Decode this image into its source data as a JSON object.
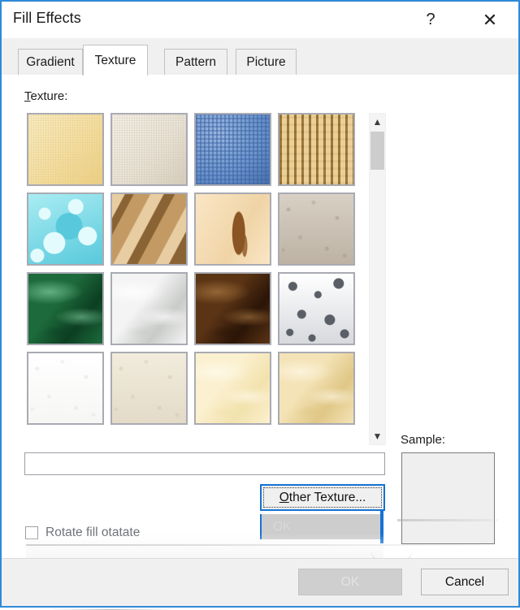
{
  "window": {
    "title": "Fill Effects",
    "help_icon": "question-mark-icon",
    "close_icon": "close-icon",
    "border_color": "#2f8ad9"
  },
  "tabs": [
    {
      "label": "Gradient",
      "active": false
    },
    {
      "label": "Texture",
      "active": true
    },
    {
      "label": "Pattern",
      "active": false
    },
    {
      "label": "Picture",
      "active": false
    }
  ],
  "texture_section": {
    "label": "Texture:",
    "accelerator": "T",
    "selected_name": "",
    "name_placeholder": "",
    "swatches": [
      {
        "name": "Papyrus",
        "c1": "#f2dda2",
        "c2": "#e8c878",
        "c3": "#f7ecc8",
        "kind": "weave-fine"
      },
      {
        "name": "Canvas",
        "c1": "#e9e2d5",
        "c2": "#cdc4b2",
        "c3": "#f4efe6",
        "kind": "weave-fine"
      },
      {
        "name": "Denim",
        "c1": "#6a93cc",
        "c2": "#3e65a3",
        "c3": "#9ab6e0",
        "kind": "weave-coarse"
      },
      {
        "name": "Woven mat",
        "c1": "#d8b169",
        "c2": "#8f6a2c",
        "c3": "#f0d7a4",
        "kind": "woven"
      },
      {
        "name": "Water droplets",
        "c1": "#a9ecf2",
        "c2": "#58c9dc",
        "c3": "#e4fbfd",
        "kind": "droplets"
      },
      {
        "name": "Paper bag",
        "c1": "#c49a64",
        "c2": "#8a6334",
        "c3": "#e8cda2",
        "kind": "crumple"
      },
      {
        "name": "Fish fossil",
        "c1": "#f0d4a6",
        "c2": "#8a5522",
        "c3": "#fae6c6",
        "kind": "fossil"
      },
      {
        "name": "Sand",
        "c1": "#bdb2a4",
        "c2": "#8e8173",
        "c3": "#d8d0c4",
        "kind": "grain"
      },
      {
        "name": "Green marble",
        "c1": "#1d6b3c",
        "c2": "#0c3f22",
        "c3": "#74c093",
        "kind": "marble"
      },
      {
        "name": "White marble",
        "c1": "#f3f4f3",
        "c2": "#c9cbc9",
        "c3": "#ffffff",
        "kind": "marble"
      },
      {
        "name": "Brown marble",
        "c1": "#5b3415",
        "c2": "#2a1507",
        "c3": "#a2713c",
        "kind": "marble"
      },
      {
        "name": "Granite",
        "c1": "#d7d9dd",
        "c2": "#5a5e66",
        "c3": "#ffffff",
        "kind": "speckle"
      },
      {
        "name": "Newsprint",
        "c1": "#f6f6f4",
        "c2": "#d2d3d0",
        "c3": "#ffffff",
        "kind": "grain"
      },
      {
        "name": "Recycled paper",
        "c1": "#e3dbc8",
        "c2": "#c2b79c",
        "c3": "#f2ecdd",
        "kind": "grain"
      },
      {
        "name": "Parchment",
        "c1": "#fbf0cf",
        "c2": "#f2e2ad",
        "c3": "#fffaea",
        "kind": "marble"
      },
      {
        "name": "Stationery",
        "c1": "#f4e3b6",
        "c2": "#e0c786",
        "c3": "#fdf6e2",
        "kind": "marble"
      }
    ]
  },
  "scrollbar": {
    "up_icon": "chevron-up-icon",
    "down_icon": "chevron-down-icon",
    "thumb_position": "top"
  },
  "other_texture_button": {
    "label": "Other Texture...",
    "accelerator": "O",
    "focused": true,
    "focus_border_color": "#1572d3"
  },
  "sample": {
    "label": "Sample:",
    "content": ""
  },
  "rotate_checkbox": {
    "label": "Rotate fill otatate",
    "checked": false
  },
  "footer": {
    "ok_label": "OK",
    "ok_enabled": false,
    "cancel_label": "Cancel"
  },
  "artifacts": {
    "ghost_ok_label": "OK",
    "note": "repaint-ghosting"
  }
}
